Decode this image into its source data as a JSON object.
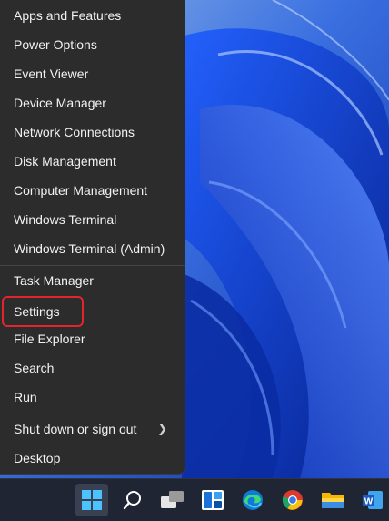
{
  "menu": {
    "items": [
      {
        "label": "Apps and Features"
      },
      {
        "label": "Power Options"
      },
      {
        "label": "Event Viewer"
      },
      {
        "label": "Device Manager"
      },
      {
        "label": "Network Connections"
      },
      {
        "label": "Disk Management"
      },
      {
        "label": "Computer Management"
      },
      {
        "label": "Windows Terminal"
      },
      {
        "label": "Windows Terminal (Admin)"
      },
      {
        "label": "Task Manager"
      },
      {
        "label": "Settings"
      },
      {
        "label": "File Explorer"
      },
      {
        "label": "Search"
      },
      {
        "label": "Run"
      },
      {
        "label": "Shut down or sign out"
      },
      {
        "label": "Desktop"
      }
    ],
    "highlight_color": "#e0262a",
    "background": "#2c2c2c"
  },
  "taskbar": {
    "icons": [
      "windows-start-icon",
      "search-icon",
      "task-view-icon",
      "widgets-icon",
      "edge-icon",
      "chrome-icon",
      "file-explorer-icon",
      "word-icon"
    ],
    "background": "#1f2532"
  }
}
